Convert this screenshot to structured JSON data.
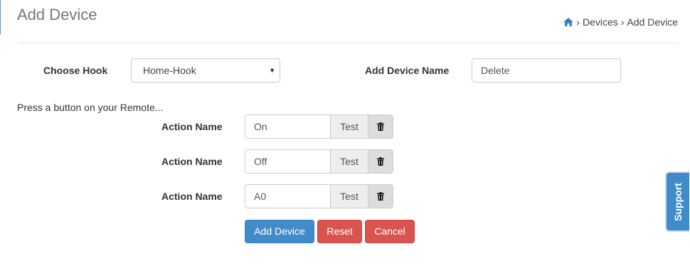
{
  "header": {
    "title": "Add Device",
    "breadcrumb": {
      "items": [
        "Devices",
        "Add Device"
      ]
    }
  },
  "form": {
    "hook_label": "Choose Hook",
    "hook_selected": "Home-Hook",
    "name_label": "Add Device Name",
    "name_value": "Delete",
    "hint": "Press a button on your Remote...",
    "actions": [
      {
        "label": "Action Name",
        "value": "On",
        "test_label": "Test"
      },
      {
        "label": "Action Name",
        "value": "Off",
        "test_label": "Test"
      },
      {
        "label": "Action Name",
        "value": "A0",
        "test_label": "Test"
      }
    ],
    "buttons": {
      "add": "Add Device",
      "reset": "Reset",
      "cancel": "Cancel"
    }
  },
  "support": {
    "label": "Support"
  },
  "icons": {
    "home": "home-icon",
    "delete": "trash-icon"
  },
  "colors": {
    "primary": "#428bca",
    "danger": "#d9534f"
  }
}
